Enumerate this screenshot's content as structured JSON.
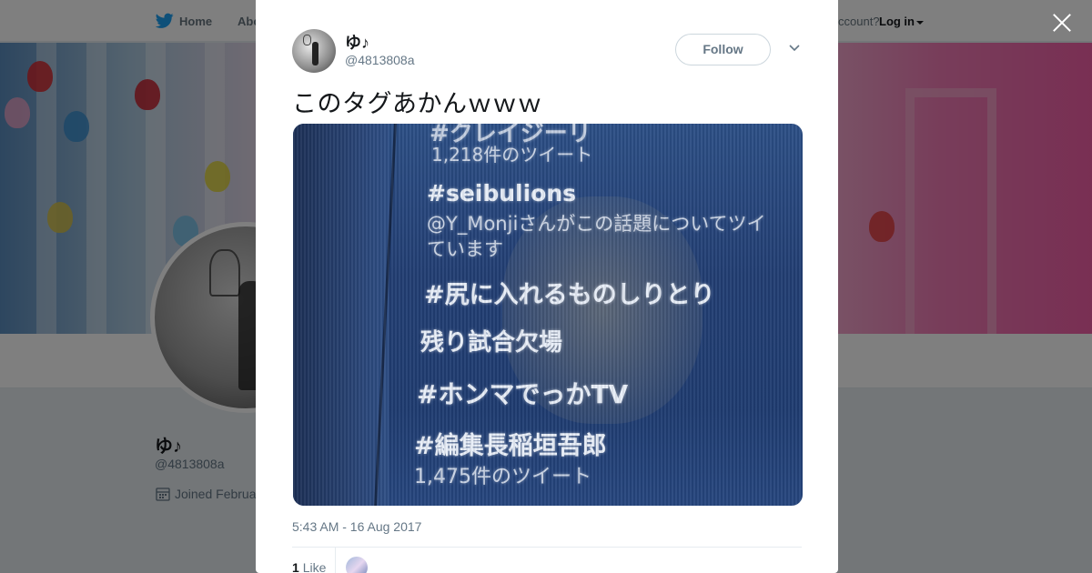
{
  "topbar": {
    "home_label": "Home",
    "about_label": "Abo",
    "account_prompt": "ccount?",
    "login_label": "Log in"
  },
  "profile": {
    "name": "ゆ♪",
    "handle": "@4813808a",
    "joined": "Joined Februa"
  },
  "tweet": {
    "author_name": "ゆ♪",
    "author_handle": "@4813808a",
    "follow_label": "Follow",
    "text": "このタグあかんｗｗｗ",
    "timestamp": "5:43 AM - 16 Aug 2017",
    "like_count": "1",
    "like_label": "Like"
  },
  "media": {
    "lines": [
      "#クレイジーリ",
      "1,218件のツイート",
      "#seibulions",
      "@Y_Monjiさんがこの話題についてツイ",
      "ています",
      "#尻に入れるものしりとり",
      "残り試合欠場",
      "#ホンマでっかTV",
      "#編集長稲垣吾郎",
      "1,475件のツイート"
    ]
  },
  "colors": {
    "twitter_blue": "#1da1f2",
    "text_primary": "#14171a",
    "text_secondary": "#657786",
    "overlay": "rgba(0,0,0,0.5)"
  },
  "icons": {
    "brand": "twitter-bird-icon",
    "close": "close-icon",
    "more": "chevron-down-icon",
    "calendar": "calendar-icon"
  }
}
